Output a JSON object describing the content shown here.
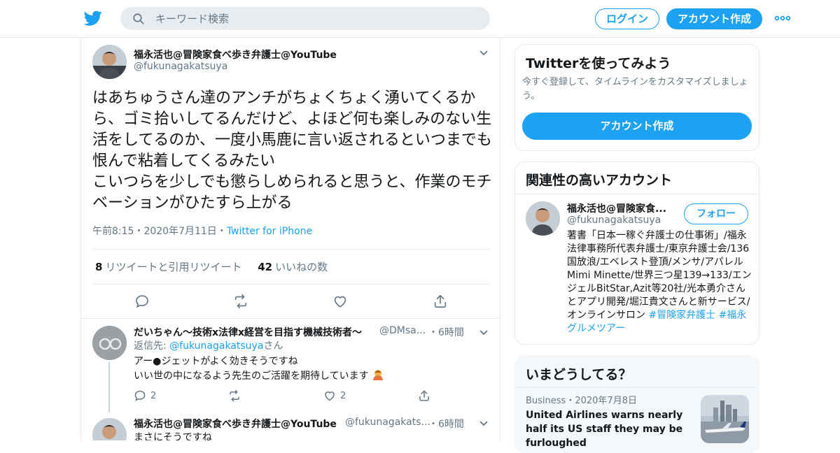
{
  "header": {
    "search_placeholder": "キーワード検索",
    "login_label": "ログイン",
    "signup_label": "アカウント作成"
  },
  "main_tweet": {
    "name": "福永活也@冒険家食べ歩き弁護士@YouTube",
    "handle": "@fukunagakatsuya",
    "text": "はあちゅうさん達のアンチがちょくちょく湧いてくるから、ゴミ拾いしてるんだけど、よほど何も楽しみのない生活をしてるのか、一度小馬鹿に言い返されるといつまでも恨んで粘着してくるみたい\nこいつらを少しでも懲らしめられると思うと、作業のモチベーションがひたすら上がる",
    "time": "午前8:15",
    "sep": "・",
    "date": "2020年7月11日",
    "source": "Twitter for iPhone",
    "retweet_count": "8",
    "retweet_label": "リツイートと引用リツイート",
    "like_count": "42",
    "like_label": "いいねの数"
  },
  "replies": [
    {
      "name": "だいちゃん～技術x法律x経営を目指す機械技術者～",
      "handle": "@DMsa...",
      "time": "・6時間",
      "reply_to_prefix": "返信先: ",
      "reply_to_handle": "@fukunagakatsuya",
      "reply_to_suffix": "さん",
      "line1": "アー●ジェットがよく効きそうですね",
      "line2": "いい世の中になるよう先生のご活躍を期待しています",
      "reply_count": "2",
      "like_count": "2"
    },
    {
      "name": "福永活也@冒険家食べ歩き弁護士@YouTube",
      "handle": "@fukunagakats...",
      "time": "・6時間",
      "line1": "まさにそうですね"
    }
  ],
  "sidebar": {
    "try_card": {
      "title": "Twitterを使ってみよう",
      "desc": "今すぐ登録して、タイムラインをカスタマイズしましょう。",
      "button": "アカウント作成"
    },
    "related": {
      "title": "関連性の高いアカウント",
      "name": "福永活也@冒険家食...",
      "handle": "@fukunagakatsuya",
      "follow_label": "フォロー",
      "bio": "著書「日本一稼ぐ弁護士の仕事術」/福永法律事務所代表弁護士/東京弁護士会/136国放浪/エベレスト登頂/メンサ/アパレルMimi Minette/世界三つ星139→133/エンジェルBitStar,Azit等20社/光本勇介さんとアプリ開発/堀江貴文さんと新サービス/オンラインサロン",
      "tag1": "#冒険家弁護士",
      "tag2": "#福永グルメツアー"
    },
    "trends": {
      "title": "いまどうしてる？",
      "category": "Business",
      "sep": "・",
      "date": "2020年7月8日",
      "headline": "United Airlines warns nearly half its US staff they may be furloughed"
    }
  },
  "colors": {
    "accent": "#1da1f2",
    "muted": "#657786",
    "border": "#e6ecf0"
  }
}
